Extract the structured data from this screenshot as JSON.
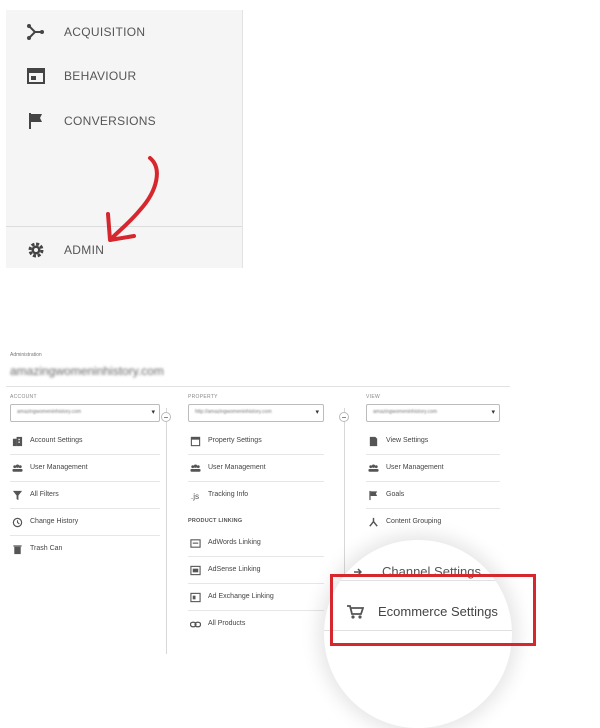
{
  "sidebar": {
    "items": [
      {
        "label": "ACQUISITION",
        "icon": "acquisition-icon"
      },
      {
        "label": "BEHAVIOUR",
        "icon": "behaviour-icon"
      },
      {
        "label": "CONVERSIONS",
        "icon": "flag-icon"
      }
    ],
    "admin_label": "ADMIN",
    "admin_icon": "gear-icon",
    "annotation_color": "#d6262e"
  },
  "admin": {
    "breadcrumb": "Administration",
    "site_name": "amazingwomeninhistory.com",
    "columns": {
      "account": {
        "header": "ACCOUNT",
        "selected": "amazingwomeninhistory.com",
        "items": [
          {
            "label": "Account Settings",
            "icon": "building-icon"
          },
          {
            "label": "User Management",
            "icon": "users-icon"
          },
          {
            "label": "All Filters",
            "icon": "filter-icon"
          },
          {
            "label": "Change History",
            "icon": "history-icon"
          },
          {
            "label": "Trash Can",
            "icon": "trash-icon"
          }
        ]
      },
      "property": {
        "header": "PROPERTY",
        "selected": "http://amazingwomeninhistory.com",
        "items": [
          {
            "label": "Property Settings",
            "icon": "settings-page-icon"
          },
          {
            "label": "User Management",
            "icon": "users-icon"
          },
          {
            "label": "Tracking Info",
            "icon": "js-icon"
          }
        ],
        "sub_header": "PRODUCT LINKING",
        "linking_items": [
          {
            "label": "AdWords Linking",
            "icon": "adwords-icon"
          },
          {
            "label": "AdSense Linking",
            "icon": "adsense-icon"
          },
          {
            "label": "Ad Exchange Linking",
            "icon": "adexchange-icon"
          },
          {
            "label": "All Products",
            "icon": "link-icon"
          }
        ]
      },
      "view": {
        "header": "VIEW",
        "selected": "amazingwomeninhistory.com",
        "items": [
          {
            "label": "View Settings",
            "icon": "document-icon"
          },
          {
            "label": "User Management",
            "icon": "users-icon"
          },
          {
            "label": "Goals",
            "icon": "flag-icon"
          },
          {
            "label": "Content Grouping",
            "icon": "grouping-icon"
          }
        ]
      }
    },
    "magnified": {
      "channel_settings": "Channel Settings",
      "ecommerce_settings": "Ecommerce Settings"
    },
    "highlight_color": "#d6262e"
  }
}
